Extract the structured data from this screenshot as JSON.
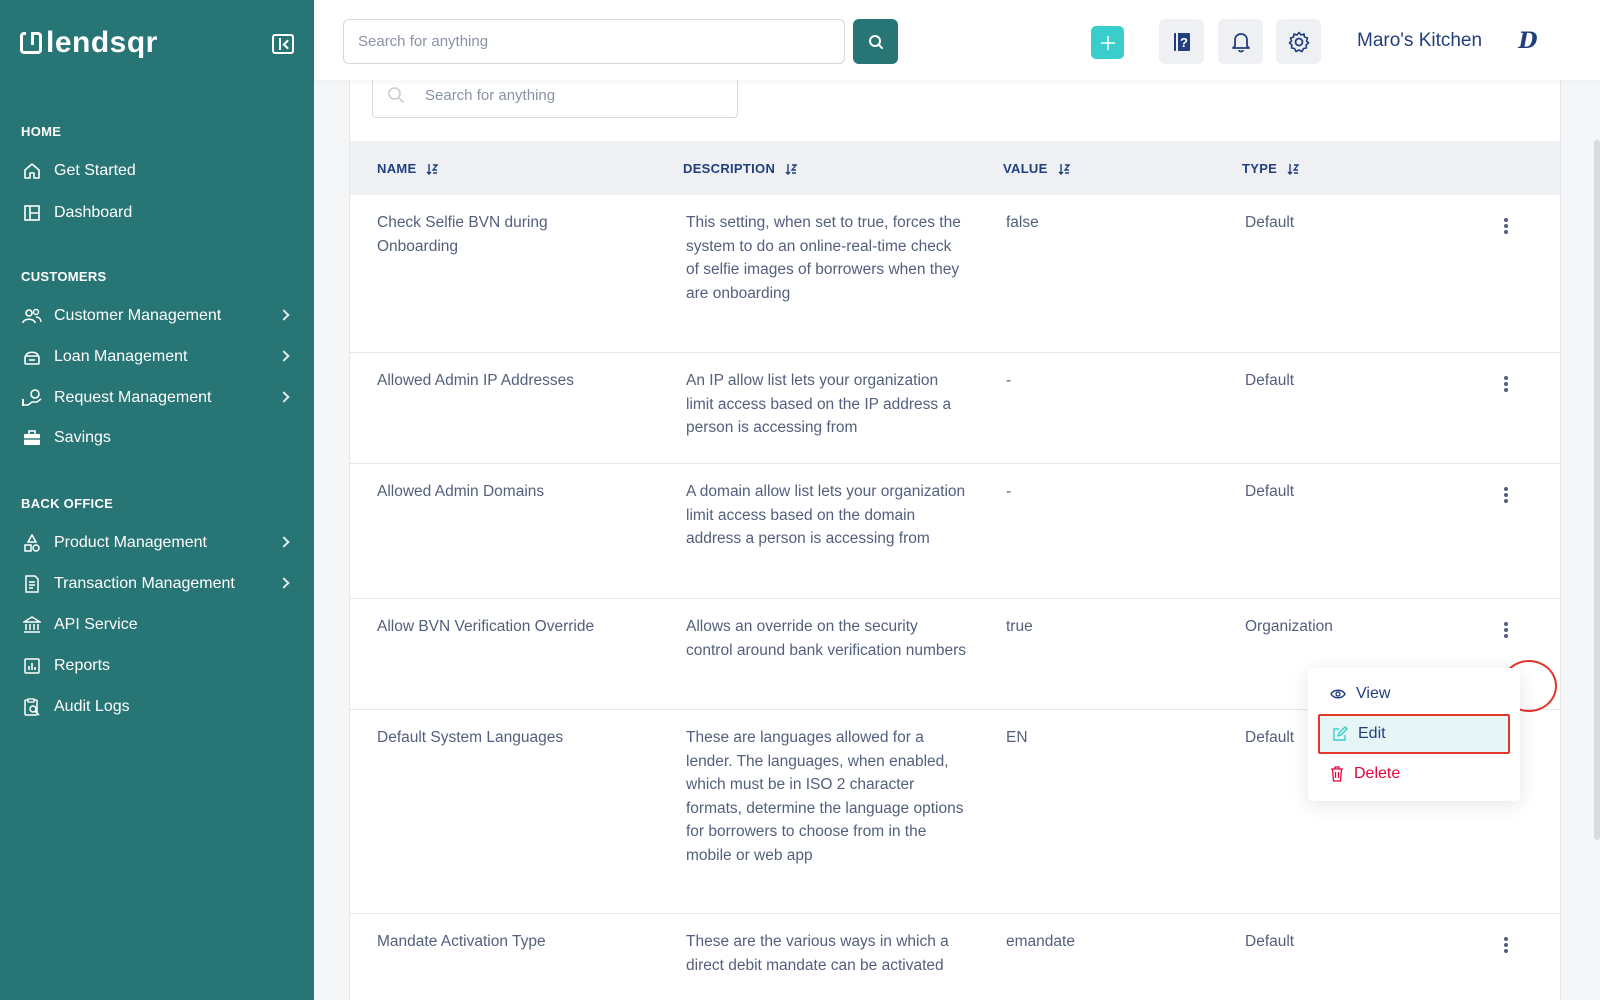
{
  "brand": {
    "name": "lendsqr"
  },
  "search": {
    "placeholder": "Search for anything"
  },
  "topbar": {
    "org_name": "Maro's Kitchen",
    "org_logo_text": "D"
  },
  "sidebar": {
    "sections": [
      {
        "title": "HOME",
        "items": [
          {
            "label": "Get Started",
            "icon": "home-icon",
            "chevron": false
          },
          {
            "label": "Dashboard",
            "icon": "dashboard-icon",
            "chevron": false
          }
        ]
      },
      {
        "title": "CUSTOMERS",
        "items": [
          {
            "label": "Customer Management",
            "icon": "users-icon",
            "chevron": true
          },
          {
            "label": "Loan Management",
            "icon": "loan-icon",
            "chevron": true
          },
          {
            "label": "Request Management",
            "icon": "request-icon",
            "chevron": true
          },
          {
            "label": "Savings",
            "icon": "briefcase-icon",
            "chevron": false
          }
        ]
      },
      {
        "title": "BACK OFFICE",
        "items": [
          {
            "label": "Product Management",
            "icon": "product-icon",
            "chevron": true
          },
          {
            "label": "Transaction Management",
            "icon": "transaction-icon",
            "chevron": true
          },
          {
            "label": "API Service",
            "icon": "bank-icon",
            "chevron": false
          },
          {
            "label": "Reports",
            "icon": "reports-icon",
            "chevron": false
          },
          {
            "label": "Audit Logs",
            "icon": "audit-icon",
            "chevron": false
          }
        ]
      }
    ]
  },
  "table": {
    "search_placeholder": "Search for anything",
    "headers": {
      "name": "NAME",
      "description": "DESCRIPTION",
      "value": "VALUE",
      "type": "TYPE"
    },
    "rows": [
      {
        "name": "Check Selfie BVN during Onboarding",
        "description": "This setting, when set to true, forces the system to do an online-real-time check of selfie images of borrowers when they are onboarding",
        "value": "false",
        "type": "Default"
      },
      {
        "name": "Allowed Admin IP Addresses",
        "description": "An IP allow list lets your organization limit access based on the IP address a person is accessing from",
        "value": "-",
        "type": "Default"
      },
      {
        "name": "Allowed Admin Domains",
        "description": "A domain allow list lets your organization limit access based on the domain address a person is accessing from",
        "value": "-",
        "type": "Default"
      },
      {
        "name": "Allow BVN Verification Override",
        "description": "Allows an override on the security control around bank verification numbers",
        "value": "true",
        "type": "Organization"
      },
      {
        "name": "Default System Languages",
        "description": "These are languages allowed for a lender. The languages, when enabled, which must be in ISO 2 character formats, determine the language options for borrowers to choose from in the mobile or web app",
        "value": "EN",
        "type": "Default"
      },
      {
        "name": "Mandate Activation Type",
        "description": "These are the various ways in which a direct debit mandate can be activated",
        "value": "emandate",
        "type": "Default"
      }
    ]
  },
  "action_menu": {
    "view": "View",
    "edit": "Edit",
    "delete": "Delete"
  },
  "colors": {
    "sidebar_bg": "#287575",
    "accent": "#39cdcc",
    "text_primary": "#213f7d",
    "danger": "#e4033b",
    "highlight": "#e0362c"
  }
}
